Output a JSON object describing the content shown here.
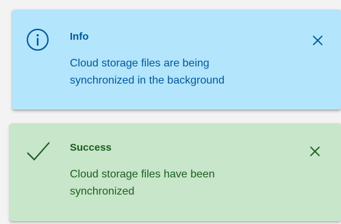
{
  "toasts": [
    {
      "severity": "info",
      "icon": "info-circle-icon",
      "title": "Info",
      "message": "Cloud storage files are being synchronized in the background",
      "background": "#b3e5fc",
      "text_color": "#01579b"
    },
    {
      "severity": "success",
      "icon": "check-icon",
      "title": "Success",
      "message": "Cloud storage files have been synchronized",
      "background": "#c8e6c9",
      "text_color": "#1b5e20"
    }
  ]
}
